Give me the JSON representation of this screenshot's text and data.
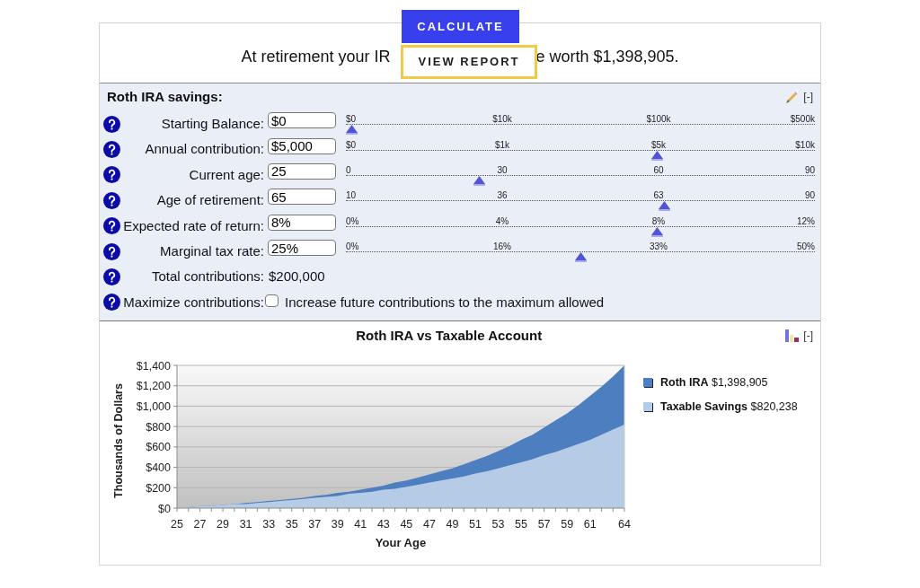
{
  "actions": [
    {
      "kind": "primary",
      "label": "CALCULATE"
    },
    {
      "kind": "outline",
      "label": "VIEW REPORT"
    }
  ],
  "summary": {
    "before": "At retirement your IR",
    "after": "e worth $1,398,905."
  },
  "form": {
    "title": "Roth IRA savings:",
    "collapse": "[-]",
    "fields": [
      {
        "kind": "slider",
        "label": "Starting Balance:",
        "value": "$0",
        "scale": [
          "$0",
          "$10k",
          "$100k",
          "$500k"
        ],
        "level": 0
      },
      {
        "kind": "slider",
        "label": "Annual contribution:",
        "value": "$5,000",
        "scale": [
          "$0",
          "$1k",
          "$5k",
          "$10k"
        ],
        "level": 0.667
      },
      {
        "kind": "slider",
        "label": "Current age:",
        "value": "25",
        "scale": [
          "0",
          "30",
          "60",
          "90"
        ],
        "level": 0.278
      },
      {
        "kind": "slider",
        "label": "Age of retirement:",
        "value": "65",
        "scale": [
          "10",
          "36",
          "63",
          "90"
        ],
        "level": 0.683
      },
      {
        "kind": "slider",
        "label": "Expected rate of return:",
        "value": "8%",
        "scale": [
          "0%",
          "4%",
          "8%",
          "12%"
        ],
        "level": 0.667
      },
      {
        "kind": "slider",
        "label": "Marginal tax rate:",
        "value": "25%",
        "scale": [
          "0%",
          "16%",
          "33%",
          "50%"
        ],
        "level": 0.5
      },
      {
        "kind": "total",
        "label": "Total contributions:",
        "value": "$200,000"
      },
      {
        "kind": "checkbox",
        "label": "Maximize contributions:",
        "checked": false,
        "text": "Increase future contributions to the maximum allowed"
      }
    ]
  },
  "chart": {
    "collapse": "[-]",
    "legend_values": [
      {
        "value": "$1,398,905"
      },
      {
        "value": "$820,238"
      }
    ],
    "chart_data": {
      "type": "area",
      "title": "Roth IRA vs Taxable Account",
      "xlabel": "Your Age",
      "ylabel": "Thousands of Dollars",
      "x": [
        25,
        26,
        27,
        28,
        29,
        30,
        31,
        32,
        33,
        34,
        35,
        36,
        37,
        38,
        39,
        40,
        41,
        42,
        43,
        44,
        45,
        46,
        47,
        48,
        49,
        50,
        51,
        52,
        53,
        54,
        55,
        56,
        57,
        58,
        59,
        60,
        61,
        62,
        63,
        64
      ],
      "series": [
        {
          "name": "Roth IRA",
          "color": "#4d7ebf",
          "values": [
            10,
            10,
            20,
            20,
            30,
            40,
            50,
            60,
            70,
            80,
            90,
            100,
            120,
            130,
            150,
            160,
            180,
            200,
            220,
            250,
            270,
            300,
            330,
            360,
            390,
            430,
            470,
            510,
            560,
            610,
            670,
            720,
            790,
            860,
            930,
            1010,
            1100,
            1190,
            1290,
            1400
          ]
        },
        {
          "name": "Taxable Savings",
          "color": "#b6cbe6",
          "values": [
            10,
            10,
            20,
            20,
            30,
            40,
            40,
            50,
            60,
            70,
            80,
            90,
            100,
            110,
            120,
            140,
            150,
            160,
            180,
            190,
            210,
            230,
            250,
            270,
            290,
            310,
            340,
            360,
            390,
            420,
            450,
            480,
            520,
            550,
            590,
            630,
            670,
            720,
            770,
            820
          ]
        }
      ],
      "xlim": [
        25,
        64
      ],
      "ylim": [
        0,
        1400
      ],
      "xticks": [
        25,
        27,
        29,
        31,
        33,
        35,
        37,
        39,
        41,
        43,
        45,
        47,
        49,
        51,
        53,
        55,
        57,
        59,
        61,
        64
      ],
      "yticks": [
        {
          "value": 0,
          "label": "$0"
        },
        {
          "value": 200,
          "label": "$200"
        },
        {
          "value": 400,
          "label": "$400"
        },
        {
          "value": 600,
          "label": "$600"
        },
        {
          "value": 800,
          "label": "$800"
        },
        {
          "value": 1000,
          "label": "$1,000"
        },
        {
          "value": 1200,
          "label": "$1,200"
        },
        {
          "value": 1400,
          "label": "$1,400"
        }
      ],
      "grid": true,
      "legend": "right",
      "stacked": false
    }
  }
}
